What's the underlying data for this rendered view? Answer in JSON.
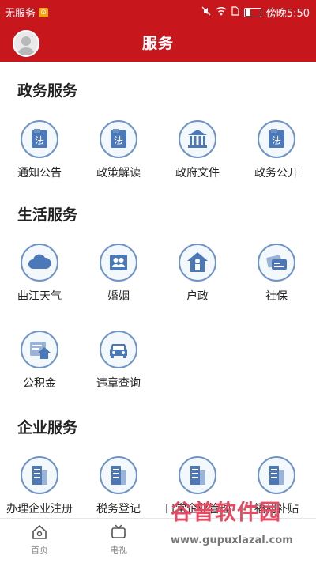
{
  "status": {
    "carrier": "无服务",
    "time": "傍晚5:50"
  },
  "header": {
    "title": "服务"
  },
  "sections": [
    {
      "title": "政务服务",
      "items": [
        {
          "label": "通知公告",
          "icon": "law-book-icon"
        },
        {
          "label": "政策解读",
          "icon": "law-book-icon"
        },
        {
          "label": "政府文件",
          "icon": "government-building-icon"
        },
        {
          "label": "政务公开",
          "icon": "law-book-icon"
        }
      ]
    },
    {
      "title": "生活服务",
      "items": [
        {
          "label": "曲江天气",
          "icon": "cloud-icon"
        },
        {
          "label": "婚姻",
          "icon": "couple-icon"
        },
        {
          "label": "户政",
          "icon": "house-person-icon"
        },
        {
          "label": "社保",
          "icon": "card-icon"
        },
        {
          "label": "公积金",
          "icon": "house-fund-icon"
        },
        {
          "label": "违章查询",
          "icon": "car-icon"
        }
      ]
    },
    {
      "title": "企业服务",
      "items": [
        {
          "label": "办理企业注册",
          "icon": "office-building-icon"
        },
        {
          "label": "税务登记",
          "icon": "office-building-icon"
        },
        {
          "label": "日常企业管理",
          "icon": "office-building-icon"
        },
        {
          "label": "福利补贴",
          "icon": "office-building-icon"
        }
      ]
    }
  ],
  "tabbar": [
    {
      "label": "首页",
      "icon": "home-icon"
    },
    {
      "label": "电视",
      "icon": "tv-icon"
    }
  ],
  "watermark": {
    "title": "谷普软件园",
    "url": "www.gupuxlazal.com"
  },
  "colors": {
    "primary": "#c8161d",
    "icon_blue": "#6f93c5",
    "icon_fill": "#4a78b8"
  }
}
